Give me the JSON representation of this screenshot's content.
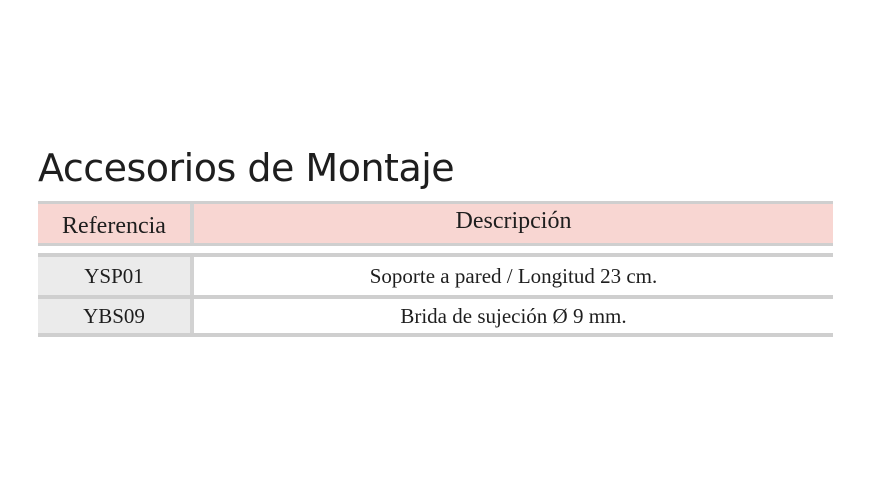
{
  "title": "Accesorios de Montaje",
  "table": {
    "headers": [
      "Referencia",
      "Descripción"
    ],
    "rows": [
      [
        "YSP01",
        "Soporte a pared / Longitud 23 cm."
      ],
      [
        "YBS09",
        "Brida de sujeción Ø 9 mm."
      ]
    ]
  },
  "colors": {
    "header_background": "#f8d6d2",
    "reference_cell_background": "#ebebeb",
    "rule_color": "#cfcfcf"
  }
}
